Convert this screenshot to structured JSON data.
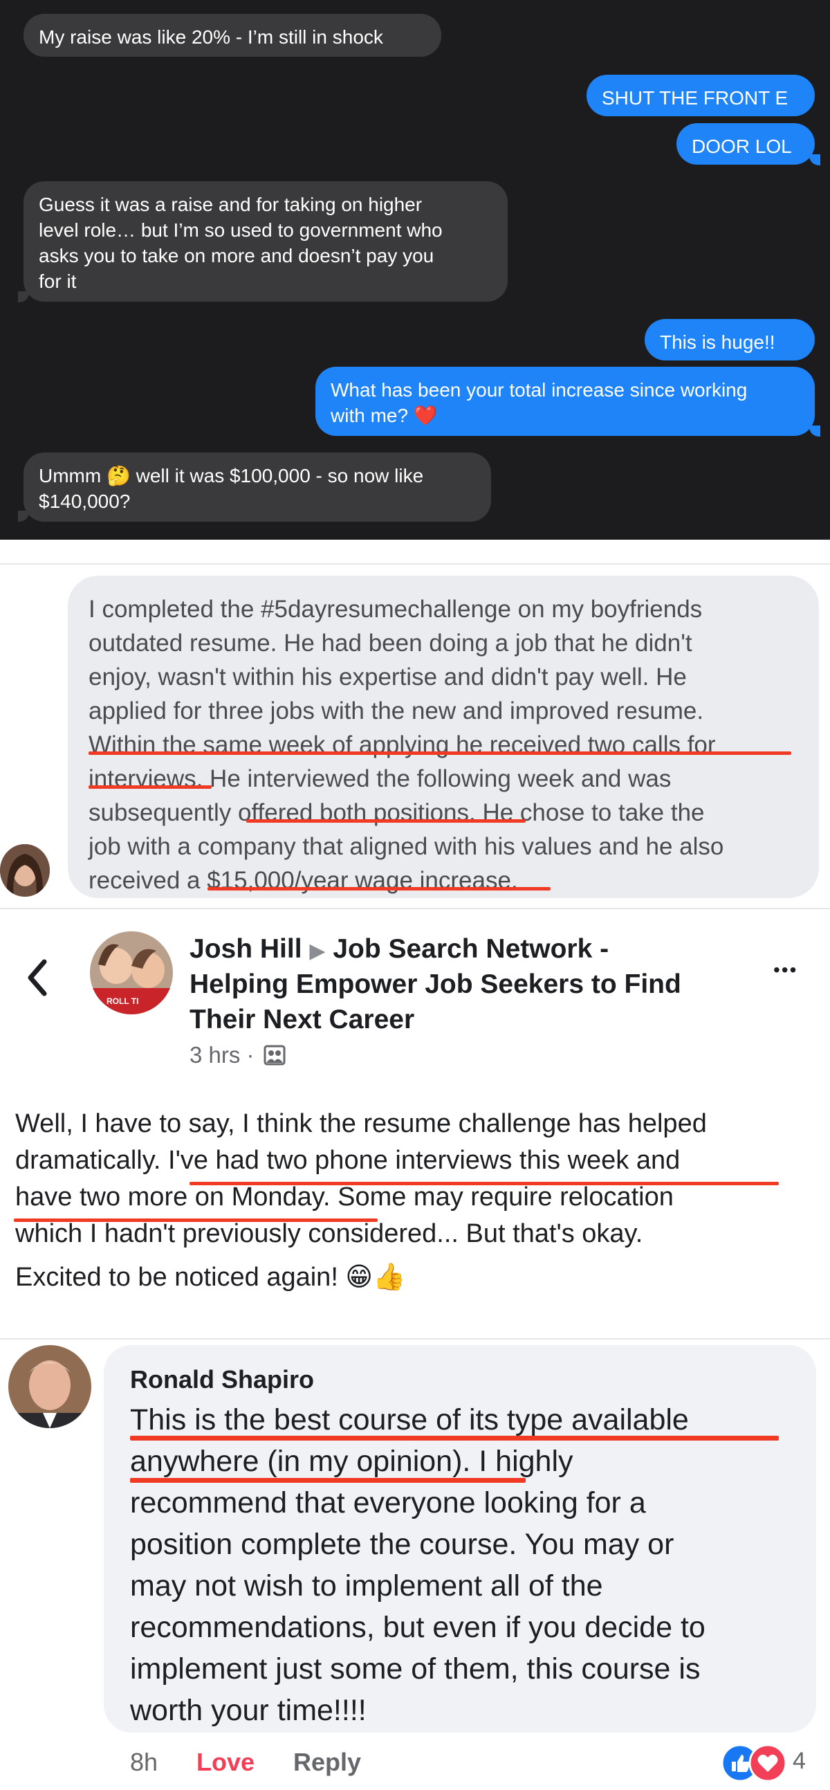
{
  "chat": {
    "messages": [
      {
        "side": "received",
        "text": "My raise was like 20% - I’m still in shock"
      },
      {
        "side": "sent",
        "text": "SHUT THE FRONT E"
      },
      {
        "side": "sent",
        "text": "DOOR LOL"
      },
      {
        "side": "received",
        "text": "Guess it was a raise and for taking on higher\nlevel role… but I’m so used to government who\nasks you to take on more and doesn’t pay you\nfor it"
      },
      {
        "side": "sent",
        "text": "This is huge!!"
      },
      {
        "side": "sent",
        "text": "What has been your total increase since working\nwith me? ❤️"
      },
      {
        "side": "received",
        "text": "Ummm 🤔 well it was $100,000 - so now like\n$140,000?"
      }
    ]
  },
  "comment1": {
    "lines": [
      "I completed the #5dayresumechallenge on my boyfriends",
      "outdated resume.  He had been doing a job that he didn't",
      "enjoy, wasn't within his expertise and didn't pay well.  He",
      "applied for three jobs with the new and improved resume.",
      "Within the same week of applying he received two calls for",
      "interviews.  He interviewed the following week and was",
      "subsequently offered both positions.  He chose to take the",
      "job with a company that aligned with his values and he also",
      "received a $15,000/year wage increase."
    ]
  },
  "post": {
    "author": "Josh Hill",
    "group_line1": "Job Search Network -",
    "group_line2": "Helping Empower Job Seekers to Find",
    "group_line3": "Their Next Career",
    "time": "3 hrs ·",
    "avatar_text": "ROLL TI",
    "body_lines": [
      "Well, I have to say, I think the resume challenge has helped",
      "dramatically. I've had two phone interviews this week and",
      "have two more on Monday. Some may require relocation",
      "which I hadn't previously considered... But that's okay.",
      "Excited to be noticed again! 😁👍"
    ],
    "more_label": "•••"
  },
  "comment2": {
    "name": "Ronald Shapiro",
    "lines": [
      "This is the best course of its type available",
      "anywhere (in my opinion).  I highly",
      "recommend that everyone looking for a",
      "position complete the course. You may or",
      "may not wish to implement all of the",
      "recommendations, but even if you decide to",
      "implement just some of them, this course is",
      "worth your time!!!!"
    ],
    "time": "8h",
    "love_label": "Love",
    "reply_label": "Reply",
    "reaction_count": "4"
  },
  "colors": {
    "chat_bg": "#1c1c1e",
    "sent_bubble": "#1e84f8",
    "received_bubble": "#3a3a3c",
    "underline": "#f03a24",
    "love": "#f33e58",
    "like": "#1877f2"
  }
}
